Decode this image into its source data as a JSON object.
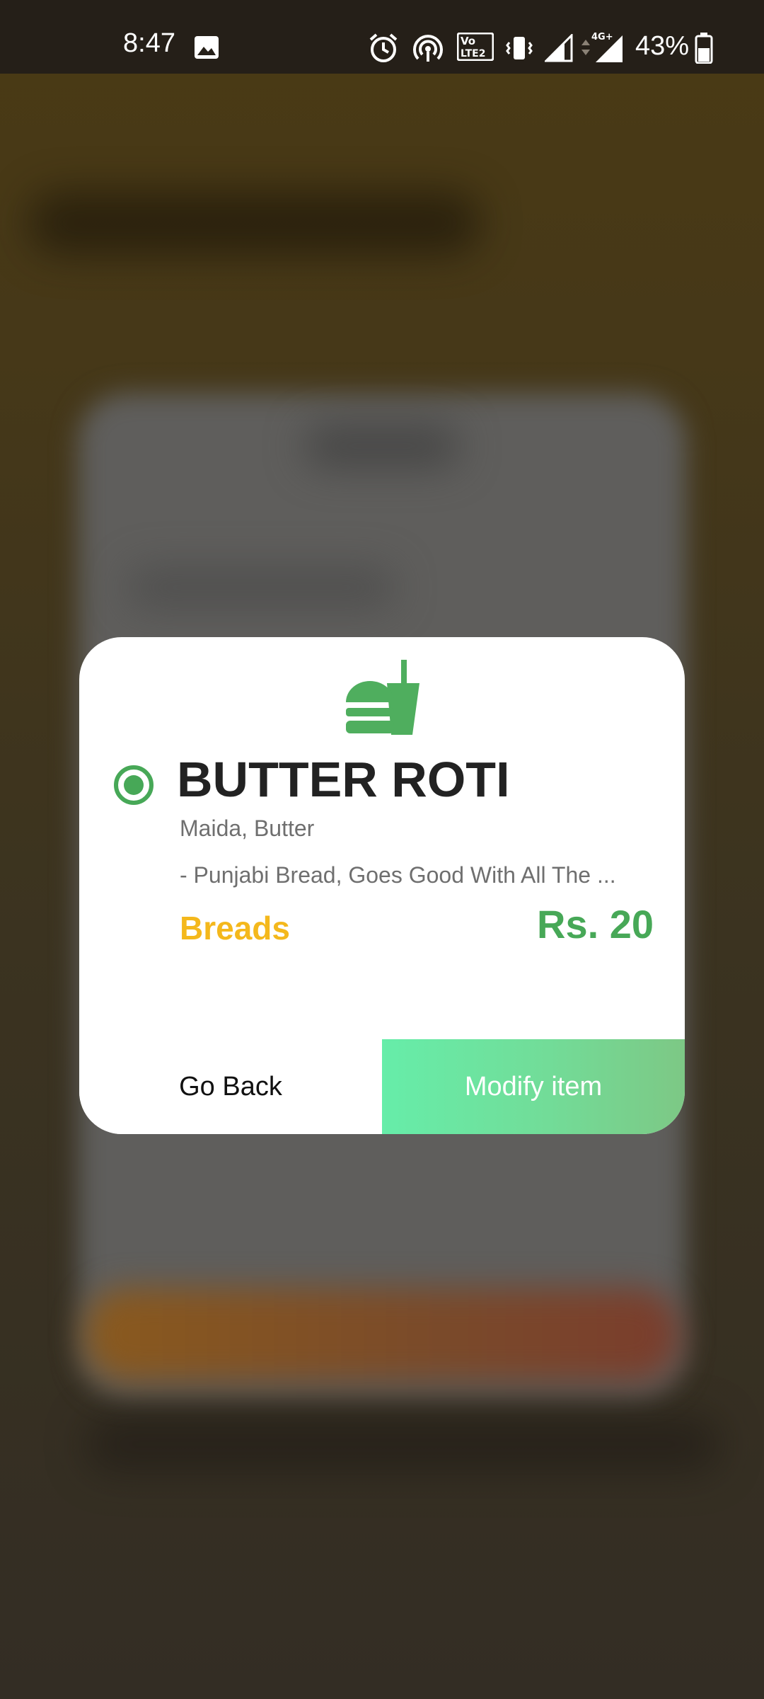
{
  "status_bar": {
    "time": "8:47",
    "battery_percent": "43%",
    "network_badge": "4G+",
    "volte_badge": "Vo LTE 2",
    "icons": [
      "gallery-icon",
      "alarm-icon",
      "hotspot-icon",
      "volte-icon",
      "vibrate-icon",
      "signal-icon",
      "mobile-data-icon",
      "battery-icon"
    ]
  },
  "dialog": {
    "icon": "fast-food-icon",
    "selected_indicator": "radio-selected-icon",
    "item_name": "BUTTER ROTI",
    "ingredients": "Maida, Butter",
    "description": "-  Punjabi Bread, Goes Good With All The ...",
    "category": "Breads",
    "price": "Rs. 20",
    "go_back_label": "Go Back",
    "modify_label": "Modify item"
  },
  "colors": {
    "accent_green": "#47a857",
    "category_yellow": "#f4b81c",
    "modify_gradient_start": "#66eda9",
    "modify_gradient_end": "#7dc885"
  }
}
